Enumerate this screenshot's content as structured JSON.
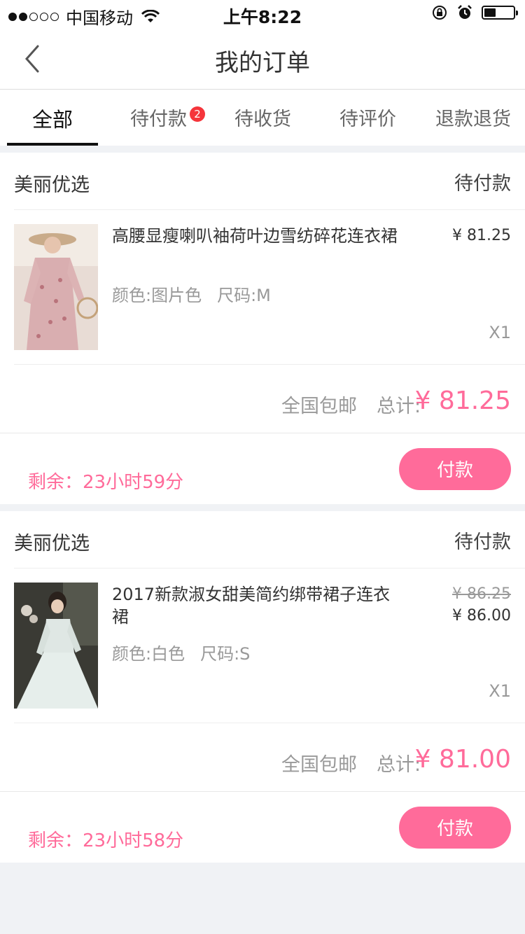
{
  "status_bar": {
    "carrier": "中国移动",
    "time": "上午8:22",
    "signal_bars_filled": 2,
    "battery_level": 0.4
  },
  "navbar": {
    "back_icon": "chevron-left-icon",
    "title": "我的订单"
  },
  "tabs": [
    {
      "label": "全部",
      "active": true
    },
    {
      "label": "待付款",
      "badge": "2"
    },
    {
      "label": "待收货"
    },
    {
      "label": "待评价"
    },
    {
      "label": "退款退货"
    }
  ],
  "orders": [
    {
      "shop": "美丽优选",
      "status": "待付款",
      "product_name": "高腰显瘦喇叭袖荷叶边雪纺碎花连衣裙",
      "color": "颜色:图片色",
      "size": "尺码:M",
      "price": "¥ 81.25",
      "qty": "X1",
      "shipping": "全国包邮",
      "total_label": "总计:",
      "total": "¥ 81.25",
      "remaining": "剩余：23小时59分",
      "pay_label": "付款"
    },
    {
      "shop": "美丽优选",
      "status": "待付款",
      "product_name": "2017新款淑女甜美简约绑带裙子连衣裙",
      "color": "颜色:白色",
      "size": "尺码:S",
      "original_price": "¥ 86.25",
      "price": "¥ 86.00",
      "qty": "X1",
      "shipping": "全国包邮",
      "total_label": "总计:",
      "total": "¥ 81.00",
      "remaining": "剩余：23小时58分",
      "pay_label": "付款"
    }
  ],
  "colors": {
    "accent_pink": "#ff6b9a",
    "badge_red": "#f5353b",
    "background": "#f0f2f5"
  }
}
